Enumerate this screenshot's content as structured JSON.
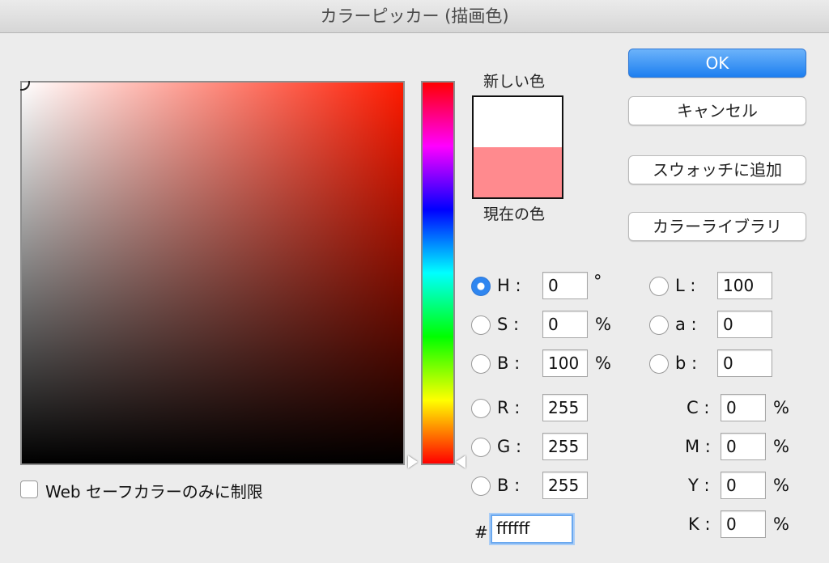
{
  "window": {
    "title": "カラーピッカー (描画色)"
  },
  "swatch": {
    "new_label": "新しい色",
    "current_label": "現在の色",
    "new_color": "#ffffff",
    "current_color": "#ff8a8e"
  },
  "buttons": {
    "ok": "OK",
    "cancel": "キャンセル",
    "add_swatch": "スウォッチに追加",
    "library": "カラーライブラリ"
  },
  "hsb": {
    "h_label": "H :",
    "h_value": "0",
    "h_unit": "°",
    "s_label": "S :",
    "s_value": "0",
    "s_unit": "%",
    "b_label": "B :",
    "b_value": "100",
    "b_unit": "%"
  },
  "rgb": {
    "r_label": "R :",
    "r_value": "255",
    "g_label": "G :",
    "g_value": "255",
    "b_label": "B :",
    "b_value": "255"
  },
  "lab": {
    "l_label": "L :",
    "l_value": "100",
    "a_label": "a :",
    "a_value": "0",
    "b_label": "b :",
    "b_value": "0"
  },
  "cmyk": {
    "c_label": "C :",
    "c_value": "0",
    "m_label": "M :",
    "m_value": "0",
    "y_label": "Y :",
    "y_value": "0",
    "k_label": "K :",
    "k_value": "0",
    "unit": "%"
  },
  "hex": {
    "label": "#",
    "value": "ffffff"
  },
  "web_safe": {
    "label": "Web セーフカラーのみに制限",
    "checked": false
  },
  "colors": {
    "accent": "#1d7ff0",
    "hue_base": "#ff1a00"
  }
}
